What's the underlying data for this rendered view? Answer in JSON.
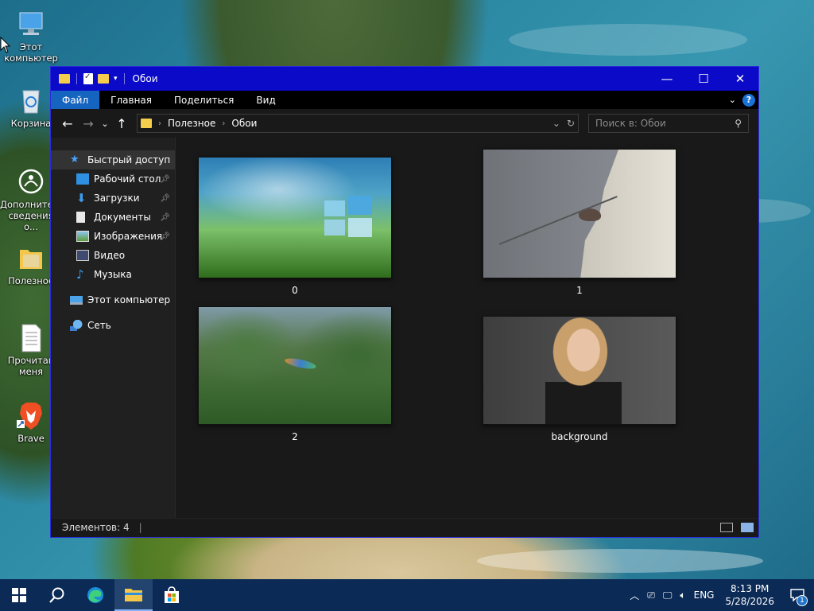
{
  "desktop": {
    "icons": [
      {
        "label": "Этот компьютер"
      },
      {
        "label": "Корзина"
      },
      {
        "label": "Дополнительные сведения о..."
      },
      {
        "label": "Полезное"
      },
      {
        "label": "Прочитай меня"
      },
      {
        "label": "Brave"
      }
    ]
  },
  "window": {
    "title": "Обои",
    "controls": {
      "minimize": "—",
      "maximize": "☐",
      "close": "✕"
    },
    "ribbon": {
      "tabs": [
        "Файл",
        "Главная",
        "Поделиться",
        "Вид"
      ],
      "help": "?"
    },
    "address": {
      "crumbs": [
        "Полезное",
        "Обои"
      ]
    },
    "search": {
      "placeholder": "Поиск в: Обои"
    },
    "sidebar": {
      "items": [
        {
          "label": "Быстрый доступ",
          "icon": "star-icon"
        },
        {
          "label": "Рабочий стол",
          "icon": "desktop-folder-icon",
          "pinned": true
        },
        {
          "label": "Загрузки",
          "icon": "downloads-icon",
          "pinned": true
        },
        {
          "label": "Документы",
          "icon": "documents-icon",
          "pinned": true
        },
        {
          "label": "Изображения",
          "icon": "pictures-icon",
          "pinned": true
        },
        {
          "label": "Видео",
          "icon": "video-icon"
        },
        {
          "label": "Музыка",
          "icon": "music-icon"
        },
        {
          "label": "Этот компьютер",
          "icon": "computer-icon"
        },
        {
          "label": "Сеть",
          "icon": "network-icon"
        }
      ]
    },
    "files": [
      {
        "name": "0"
      },
      {
        "name": "1"
      },
      {
        "name": "2"
      },
      {
        "name": "background"
      }
    ],
    "status": {
      "count": "Элементов: 4"
    }
  },
  "taskbar": {
    "lang": "ENG",
    "time": "8:13 PM",
    "date": "5/28/2026",
    "notifications": "1"
  },
  "colors": {
    "titlebar": "#0a0ac8",
    "active_tab": "#1565c0",
    "taskbar": "#0b2a56"
  }
}
